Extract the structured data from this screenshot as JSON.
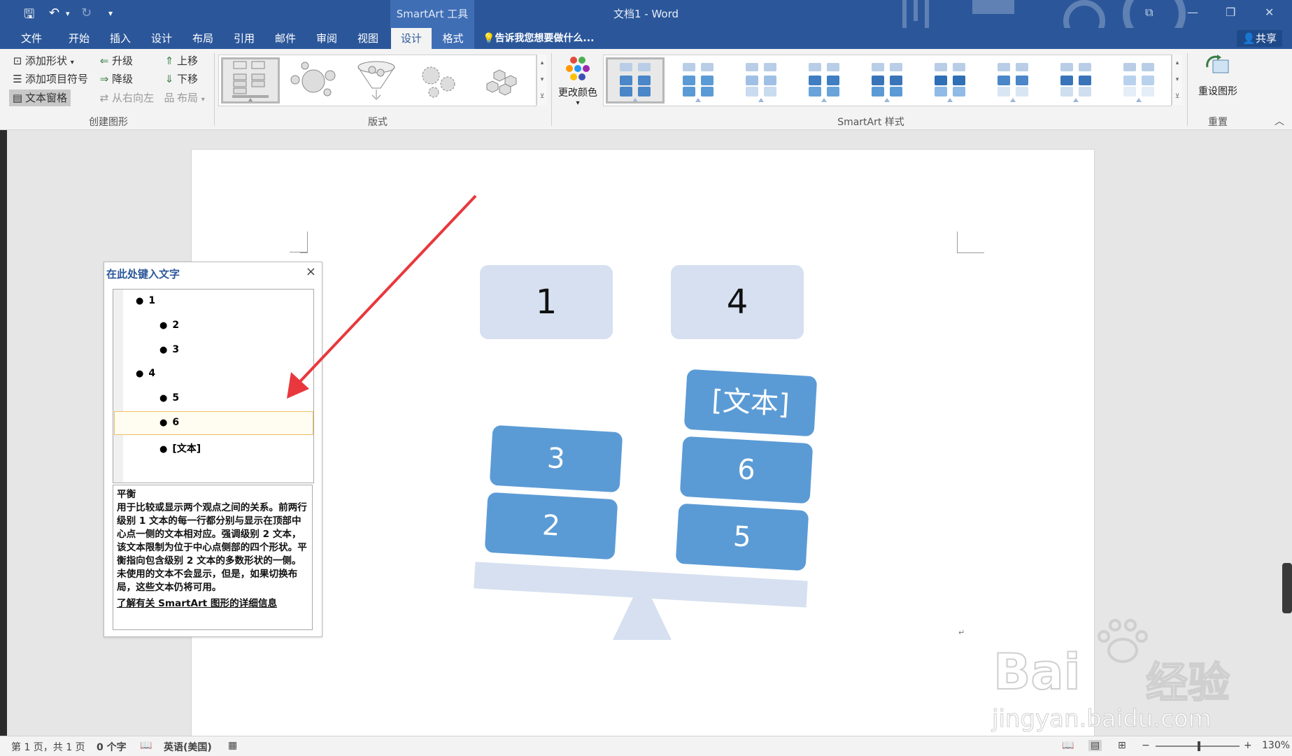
{
  "title_bar": {
    "context_tool": "SmartArt 工具",
    "doc_title": "文档1 - Word",
    "qa_customize": "▾"
  },
  "tabs": [
    {
      "label": "文件"
    },
    {
      "label": "开始"
    },
    {
      "label": "插入"
    },
    {
      "label": "设计"
    },
    {
      "label": "布局"
    },
    {
      "label": "引用"
    },
    {
      "label": "邮件"
    },
    {
      "label": "审阅"
    },
    {
      "label": "视图"
    },
    {
      "label": "设计"
    },
    {
      "label": "格式"
    }
  ],
  "tell_me": "告诉我您想要做什么...",
  "share": "共享",
  "ribbon": {
    "create": {
      "add_shape": "添加形状",
      "add_bullet": "添加项目符号",
      "text_pane": "文本窗格",
      "promote": "升级",
      "demote": "降级",
      "right_to_left": "从右向左",
      "move_up": "上移",
      "move_down": "下移",
      "layout": "布局",
      "group": "创建图形"
    },
    "layouts_group": "版式",
    "change_colors": "更改颜色",
    "styles_group": "SmartArt 样式",
    "reset_graphic": "重设图形",
    "reset_group": "重置"
  },
  "text_pane": {
    "title": "在此处键入文字",
    "items": [
      {
        "level": 1,
        "text": "1"
      },
      {
        "level": 2,
        "text": "2"
      },
      {
        "level": 2,
        "text": "3"
      },
      {
        "level": 1,
        "text": "4"
      },
      {
        "level": 2,
        "text": "5"
      },
      {
        "level": 2,
        "text": "6"
      },
      {
        "level": 2,
        "text": "[文本]"
      }
    ],
    "desc_title": "平衡",
    "description": "用于比较或显示两个观点之间的关系。前两行级别 1 文本的每一行都分别与显示在顶部中心点一侧的文本相对应。强调级别 2 文本，该文本限制为位于中心点侧部的四个形状。平衡指向包含级别 2 文本的多数形状的一侧。未使用的文本不会显示，但是，如果切换布局，这些文本仍将可用。",
    "link": "了解有关 SmartArt 图形的详细信息"
  },
  "smartart": {
    "top_left": "1",
    "top_right": "4",
    "left_stack": [
      "3",
      "2"
    ],
    "right_stack": [
      "[文本]",
      "6",
      "5"
    ],
    "colors": {
      "light": "#d6e0f0",
      "dark": "#5b9bd5"
    }
  },
  "status": {
    "page": "第 1 页，共 1 页",
    "words": "0 个字",
    "language": "英语(美国)",
    "zoom": "130%"
  },
  "watermark": {
    "brand": "Bai",
    "cn": "经验",
    "url": "jingyan.baidu.com"
  },
  "accent": "#2b579a"
}
